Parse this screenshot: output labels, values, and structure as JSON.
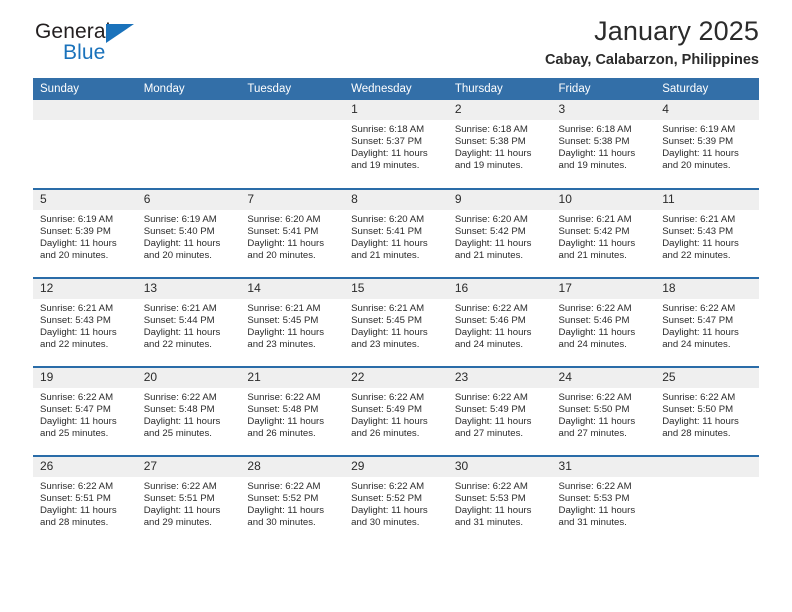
{
  "brand": {
    "line1": "General",
    "line2": "Blue",
    "accent_color": "#1a72bb",
    "triangle_icon": "brand-triangle-icon"
  },
  "header": {
    "title": "January 2025",
    "subtitle": "Cabay, Calabarzon, Philippines"
  },
  "calendar": {
    "header_bg": "#336fa8",
    "header_text_color": "#ffffff",
    "row_divider_color": "#2a6ca8",
    "daynum_bg": "#efefef",
    "weekdays": [
      "Sunday",
      "Monday",
      "Tuesday",
      "Wednesday",
      "Thursday",
      "Friday",
      "Saturday"
    ],
    "weeks": [
      [
        {
          "day": "",
          "empty": true
        },
        {
          "day": "",
          "empty": true
        },
        {
          "day": "",
          "empty": true
        },
        {
          "day": "1",
          "sunrise": "Sunrise: 6:18 AM",
          "sunset": "Sunset: 5:37 PM",
          "daylight1": "Daylight: 11 hours",
          "daylight2": "and 19 minutes."
        },
        {
          "day": "2",
          "sunrise": "Sunrise: 6:18 AM",
          "sunset": "Sunset: 5:38 PM",
          "daylight1": "Daylight: 11 hours",
          "daylight2": "and 19 minutes."
        },
        {
          "day": "3",
          "sunrise": "Sunrise: 6:18 AM",
          "sunset": "Sunset: 5:38 PM",
          "daylight1": "Daylight: 11 hours",
          "daylight2": "and 19 minutes."
        },
        {
          "day": "4",
          "sunrise": "Sunrise: 6:19 AM",
          "sunset": "Sunset: 5:39 PM",
          "daylight1": "Daylight: 11 hours",
          "daylight2": "and 20 minutes."
        }
      ],
      [
        {
          "day": "5",
          "sunrise": "Sunrise: 6:19 AM",
          "sunset": "Sunset: 5:39 PM",
          "daylight1": "Daylight: 11 hours",
          "daylight2": "and 20 minutes."
        },
        {
          "day": "6",
          "sunrise": "Sunrise: 6:19 AM",
          "sunset": "Sunset: 5:40 PM",
          "daylight1": "Daylight: 11 hours",
          "daylight2": "and 20 minutes."
        },
        {
          "day": "7",
          "sunrise": "Sunrise: 6:20 AM",
          "sunset": "Sunset: 5:41 PM",
          "daylight1": "Daylight: 11 hours",
          "daylight2": "and 20 minutes."
        },
        {
          "day": "8",
          "sunrise": "Sunrise: 6:20 AM",
          "sunset": "Sunset: 5:41 PM",
          "daylight1": "Daylight: 11 hours",
          "daylight2": "and 21 minutes."
        },
        {
          "day": "9",
          "sunrise": "Sunrise: 6:20 AM",
          "sunset": "Sunset: 5:42 PM",
          "daylight1": "Daylight: 11 hours",
          "daylight2": "and 21 minutes."
        },
        {
          "day": "10",
          "sunrise": "Sunrise: 6:21 AM",
          "sunset": "Sunset: 5:42 PM",
          "daylight1": "Daylight: 11 hours",
          "daylight2": "and 21 minutes."
        },
        {
          "day": "11",
          "sunrise": "Sunrise: 6:21 AM",
          "sunset": "Sunset: 5:43 PM",
          "daylight1": "Daylight: 11 hours",
          "daylight2": "and 22 minutes."
        }
      ],
      [
        {
          "day": "12",
          "sunrise": "Sunrise: 6:21 AM",
          "sunset": "Sunset: 5:43 PM",
          "daylight1": "Daylight: 11 hours",
          "daylight2": "and 22 minutes."
        },
        {
          "day": "13",
          "sunrise": "Sunrise: 6:21 AM",
          "sunset": "Sunset: 5:44 PM",
          "daylight1": "Daylight: 11 hours",
          "daylight2": "and 22 minutes."
        },
        {
          "day": "14",
          "sunrise": "Sunrise: 6:21 AM",
          "sunset": "Sunset: 5:45 PM",
          "daylight1": "Daylight: 11 hours",
          "daylight2": "and 23 minutes."
        },
        {
          "day": "15",
          "sunrise": "Sunrise: 6:21 AM",
          "sunset": "Sunset: 5:45 PM",
          "daylight1": "Daylight: 11 hours",
          "daylight2": "and 23 minutes."
        },
        {
          "day": "16",
          "sunrise": "Sunrise: 6:22 AM",
          "sunset": "Sunset: 5:46 PM",
          "daylight1": "Daylight: 11 hours",
          "daylight2": "and 24 minutes."
        },
        {
          "day": "17",
          "sunrise": "Sunrise: 6:22 AM",
          "sunset": "Sunset: 5:46 PM",
          "daylight1": "Daylight: 11 hours",
          "daylight2": "and 24 minutes."
        },
        {
          "day": "18",
          "sunrise": "Sunrise: 6:22 AM",
          "sunset": "Sunset: 5:47 PM",
          "daylight1": "Daylight: 11 hours",
          "daylight2": "and 24 minutes."
        }
      ],
      [
        {
          "day": "19",
          "sunrise": "Sunrise: 6:22 AM",
          "sunset": "Sunset: 5:47 PM",
          "daylight1": "Daylight: 11 hours",
          "daylight2": "and 25 minutes."
        },
        {
          "day": "20",
          "sunrise": "Sunrise: 6:22 AM",
          "sunset": "Sunset: 5:48 PM",
          "daylight1": "Daylight: 11 hours",
          "daylight2": "and 25 minutes."
        },
        {
          "day": "21",
          "sunrise": "Sunrise: 6:22 AM",
          "sunset": "Sunset: 5:48 PM",
          "daylight1": "Daylight: 11 hours",
          "daylight2": "and 26 minutes."
        },
        {
          "day": "22",
          "sunrise": "Sunrise: 6:22 AM",
          "sunset": "Sunset: 5:49 PM",
          "daylight1": "Daylight: 11 hours",
          "daylight2": "and 26 minutes."
        },
        {
          "day": "23",
          "sunrise": "Sunrise: 6:22 AM",
          "sunset": "Sunset: 5:49 PM",
          "daylight1": "Daylight: 11 hours",
          "daylight2": "and 27 minutes."
        },
        {
          "day": "24",
          "sunrise": "Sunrise: 6:22 AM",
          "sunset": "Sunset: 5:50 PM",
          "daylight1": "Daylight: 11 hours",
          "daylight2": "and 27 minutes."
        },
        {
          "day": "25",
          "sunrise": "Sunrise: 6:22 AM",
          "sunset": "Sunset: 5:50 PM",
          "daylight1": "Daylight: 11 hours",
          "daylight2": "and 28 minutes."
        }
      ],
      [
        {
          "day": "26",
          "sunrise": "Sunrise: 6:22 AM",
          "sunset": "Sunset: 5:51 PM",
          "daylight1": "Daylight: 11 hours",
          "daylight2": "and 28 minutes."
        },
        {
          "day": "27",
          "sunrise": "Sunrise: 6:22 AM",
          "sunset": "Sunset: 5:51 PM",
          "daylight1": "Daylight: 11 hours",
          "daylight2": "and 29 minutes."
        },
        {
          "day": "28",
          "sunrise": "Sunrise: 6:22 AM",
          "sunset": "Sunset: 5:52 PM",
          "daylight1": "Daylight: 11 hours",
          "daylight2": "and 30 minutes."
        },
        {
          "day": "29",
          "sunrise": "Sunrise: 6:22 AM",
          "sunset": "Sunset: 5:52 PM",
          "daylight1": "Daylight: 11 hours",
          "daylight2": "and 30 minutes."
        },
        {
          "day": "30",
          "sunrise": "Sunrise: 6:22 AM",
          "sunset": "Sunset: 5:53 PM",
          "daylight1": "Daylight: 11 hours",
          "daylight2": "and 31 minutes."
        },
        {
          "day": "31",
          "sunrise": "Sunrise: 6:22 AM",
          "sunset": "Sunset: 5:53 PM",
          "daylight1": "Daylight: 11 hours",
          "daylight2": "and 31 minutes."
        },
        {
          "day": "",
          "empty": true
        }
      ]
    ]
  }
}
